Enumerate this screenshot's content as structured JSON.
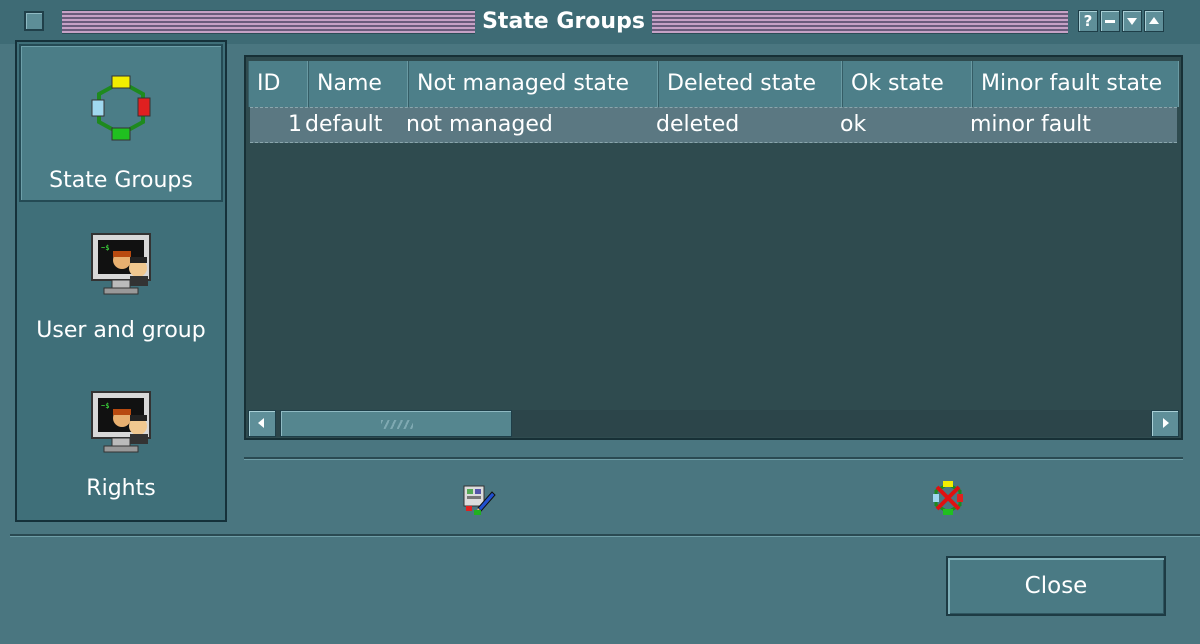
{
  "window": {
    "title": "State Groups",
    "buttons": {
      "help": "?"
    }
  },
  "sidebar": {
    "items": [
      {
        "label": "State Groups",
        "icon": "state-groups-icon",
        "selected": true
      },
      {
        "label": "User and group",
        "icon": "user-monitor-icon",
        "selected": false
      },
      {
        "label": "Rights",
        "icon": "user-monitor-icon",
        "selected": false
      }
    ]
  },
  "table": {
    "columns": [
      "ID",
      "Name",
      "Not managed state",
      "Deleted state",
      "Ok state",
      "Minor fault state"
    ],
    "rows": [
      {
        "id": "1",
        "name": "default",
        "not_managed": "not managed",
        "deleted": "deleted",
        "ok": "ok",
        "minor_fault": "minor fault"
      }
    ]
  },
  "actions": {
    "edit_icon": "edit-icon",
    "delete_icon": "delete-icon"
  },
  "footer": {
    "close_label": "Close"
  },
  "colors": {
    "background": "#4a7680",
    "table_bg": "#2f4b4f",
    "header_bg": "#4d7f89"
  }
}
